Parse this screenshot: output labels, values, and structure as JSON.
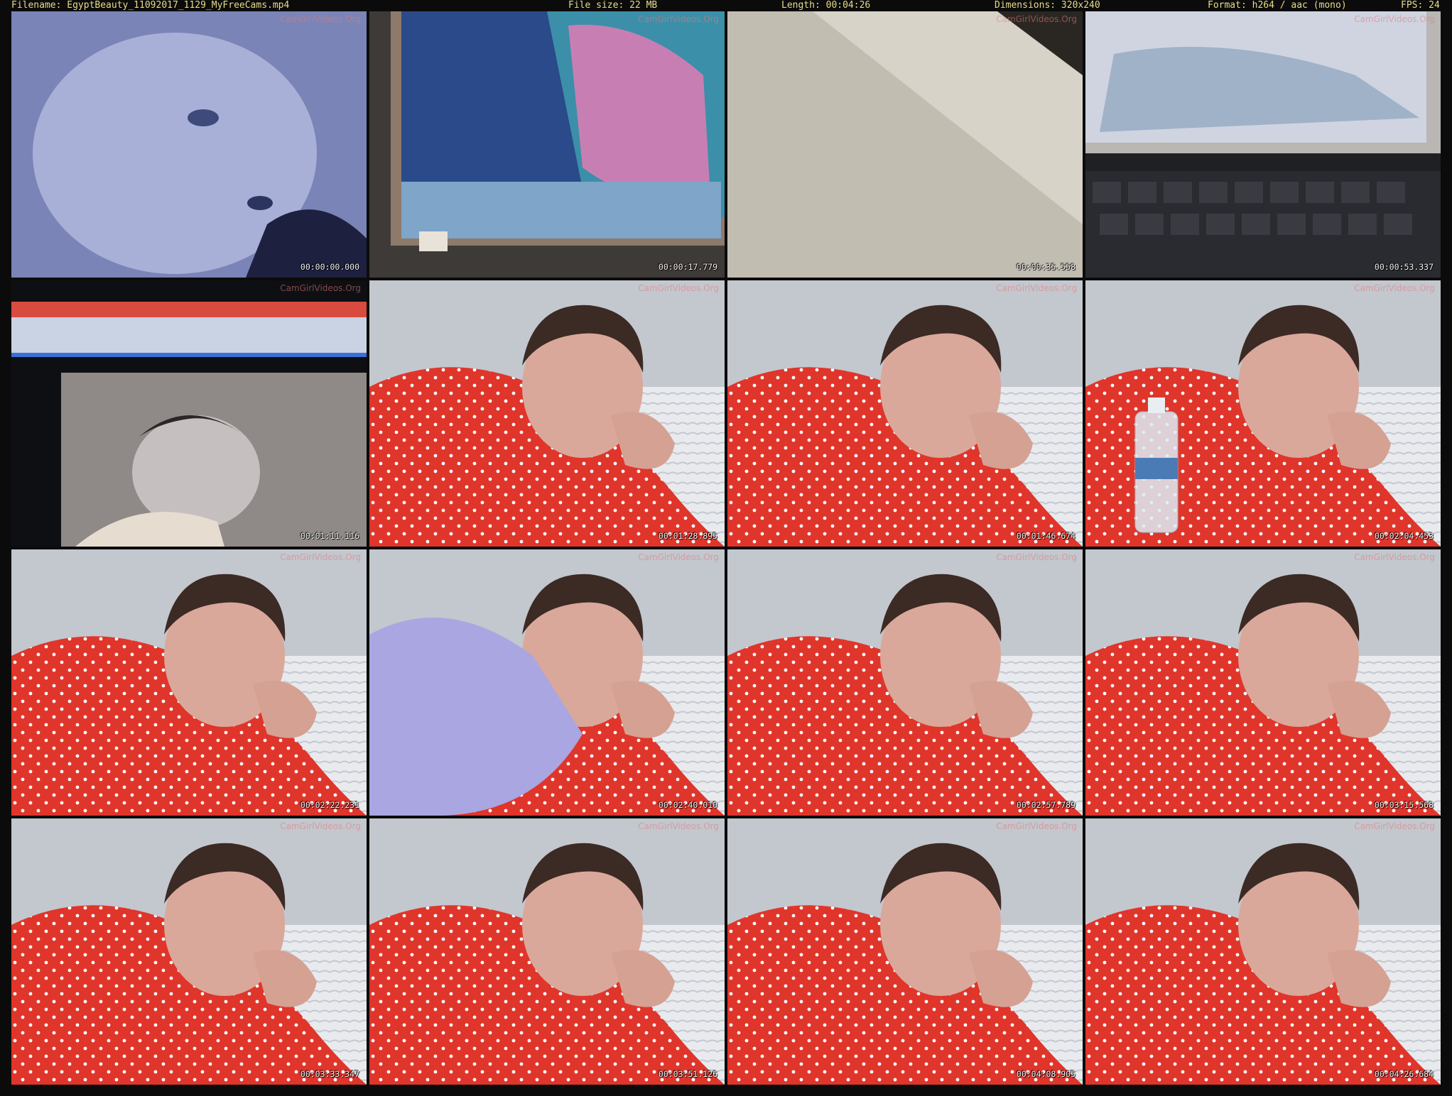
{
  "header": {
    "filename": "Filename: EgyptBeauty_11092017_1129_MyFreeCams.mp4",
    "filesize": "File size: 22 MB",
    "length": "Length: 00:04:26",
    "dimensions": "Dimensions: 320x240",
    "format": "Format: h264 / aac (mono)",
    "fps": "FPS: 24"
  },
  "watermark": "CamGirlVideos.Org",
  "thumbnails": [
    {
      "timestamp": "00:00:00.000",
      "scene": "blurred-face"
    },
    {
      "timestamp": "00:00:17.779",
      "scene": "laptop-screen"
    },
    {
      "timestamp": "00:00:35.558",
      "scene": "wall"
    },
    {
      "timestamp": "00:00:53.337",
      "scene": "laptop-keyboard"
    },
    {
      "timestamp": "00:01:11.116",
      "scene": "monitor-browser"
    },
    {
      "timestamp": "00:01:28.895",
      "scene": "woman-red-dress"
    },
    {
      "timestamp": "00:01:46.674",
      "scene": "woman-red-dress"
    },
    {
      "timestamp": "00:02:04.453",
      "scene": "woman-red-dress-bottle"
    },
    {
      "timestamp": "00:02:22.231",
      "scene": "woman-red-dress"
    },
    {
      "timestamp": "00:02:40.010",
      "scene": "woman-red-dress-cloth"
    },
    {
      "timestamp": "00:02:57.789",
      "scene": "woman-red-dress"
    },
    {
      "timestamp": "00:03:15.568",
      "scene": "woman-red-dress"
    },
    {
      "timestamp": "00:03:33.347",
      "scene": "woman-red-dress"
    },
    {
      "timestamp": "00:03:51.126",
      "scene": "woman-red-dress"
    },
    {
      "timestamp": "00:04:08.905",
      "scene": "woman-red-dress"
    },
    {
      "timestamp": "00:04:26.684",
      "scene": "woman-red-dress"
    }
  ],
  "colors": {
    "background": "#0b0b0b",
    "header_text": "#e8dc8a",
    "timestamp_text": "#f2f2f2",
    "dress_red": "#e0352b",
    "dot_white": "#ffffff"
  }
}
